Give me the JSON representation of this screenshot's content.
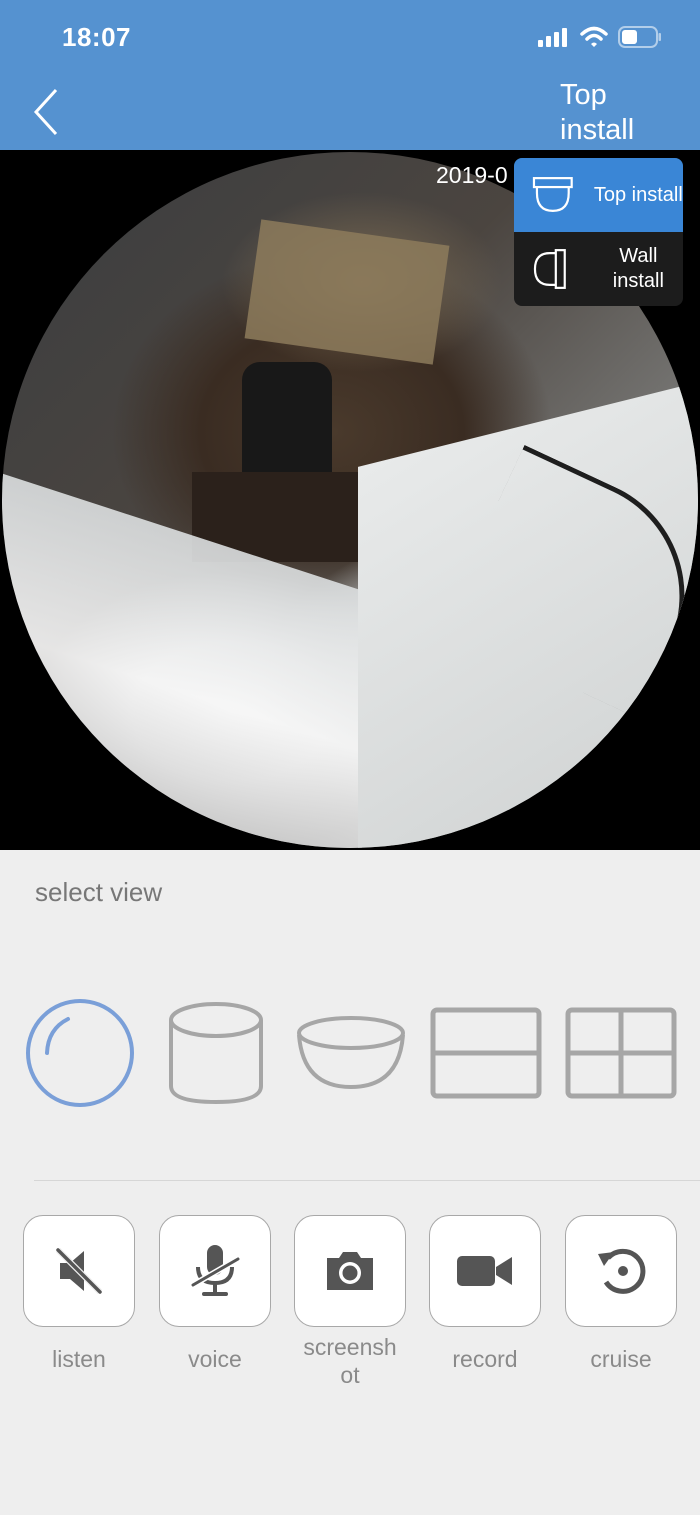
{
  "status_bar": {
    "time": "18:07",
    "icons": [
      "cellular-signal-icon",
      "wifi-icon",
      "battery-icon"
    ]
  },
  "nav": {
    "back_icon": "chevron-left-icon",
    "title": "Top install"
  },
  "video": {
    "timestamp": "2019-0",
    "install_menu": [
      {
        "label": "Top install",
        "icon": "ceiling-dome-camera-icon",
        "active": true
      },
      {
        "label": "Wall install",
        "icon": "wall-dome-camera-icon",
        "active": false
      }
    ]
  },
  "view_section": {
    "label": "select view",
    "views": [
      {
        "name": "fisheye",
        "icon": "fisheye-circle-icon",
        "selected": true
      },
      {
        "name": "cylinder",
        "icon": "cylinder-icon",
        "selected": false
      },
      {
        "name": "bowl",
        "icon": "bowl-hemisphere-icon",
        "selected": false
      },
      {
        "name": "two-split",
        "icon": "two-split-grid-icon",
        "selected": false
      },
      {
        "name": "four-split",
        "icon": "four-split-grid-icon",
        "selected": false
      }
    ]
  },
  "actions": [
    {
      "label": "listen",
      "icon": "speaker-muted-icon"
    },
    {
      "label": "voice",
      "icon": "microphone-muted-icon"
    },
    {
      "label": "screensh\not",
      "icon": "camera-icon"
    },
    {
      "label": "record",
      "icon": "video-camera-icon"
    },
    {
      "label": "cruise",
      "icon": "rotate-cruise-icon"
    }
  ],
  "colors": {
    "header_bg": "#5592d0",
    "accent_selected": "#7a9fd8",
    "menu_active": "#3a86d6",
    "icon_inactive": "#a6a6a6",
    "icon_dark": "#555555"
  }
}
